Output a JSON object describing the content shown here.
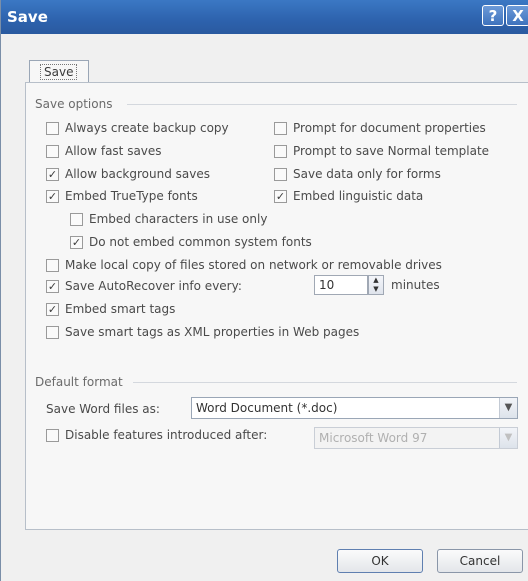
{
  "window": {
    "title": "Save",
    "help_glyph": "?",
    "close_glyph": "X"
  },
  "tabs": [
    {
      "label": "Save"
    }
  ],
  "save_options": {
    "heading": "Save options",
    "left": [
      {
        "label": "Always create backup copy",
        "checked": false
      },
      {
        "label": "Allow fast saves",
        "checked": false
      },
      {
        "label": "Allow background saves",
        "checked": true
      },
      {
        "label": "Embed TrueType fonts",
        "checked": true
      }
    ],
    "right": [
      {
        "label": "Prompt for document properties",
        "checked": false
      },
      {
        "label": "Prompt to save Normal template",
        "checked": false
      },
      {
        "label": "Save data only for forms",
        "checked": false
      },
      {
        "label": "Embed linguistic data",
        "checked": true
      }
    ],
    "sub": [
      {
        "label": "Embed characters in use only",
        "checked": false
      },
      {
        "label": "Do not embed common system fonts",
        "checked": true
      }
    ],
    "wide": [
      {
        "label": "Make local copy of files stored on network or removable drives",
        "checked": false
      },
      {
        "label": "Save AutoRecover info every:",
        "checked": true
      },
      {
        "label": "Embed smart tags",
        "checked": true
      },
      {
        "label": "Save smart tags as XML properties in Web pages",
        "checked": false
      }
    ],
    "autorecover_value": "10",
    "autorecover_unit": "minutes"
  },
  "default_format": {
    "heading": "Default format",
    "save_as_label": "Save Word files as:",
    "save_as_value": "Word Document (*.doc)",
    "disable_label": "Disable features introduced after:",
    "disable_checked": false,
    "disable_value": "Microsoft Word 97"
  },
  "buttons": {
    "ok": "OK",
    "cancel": "Cancel"
  }
}
